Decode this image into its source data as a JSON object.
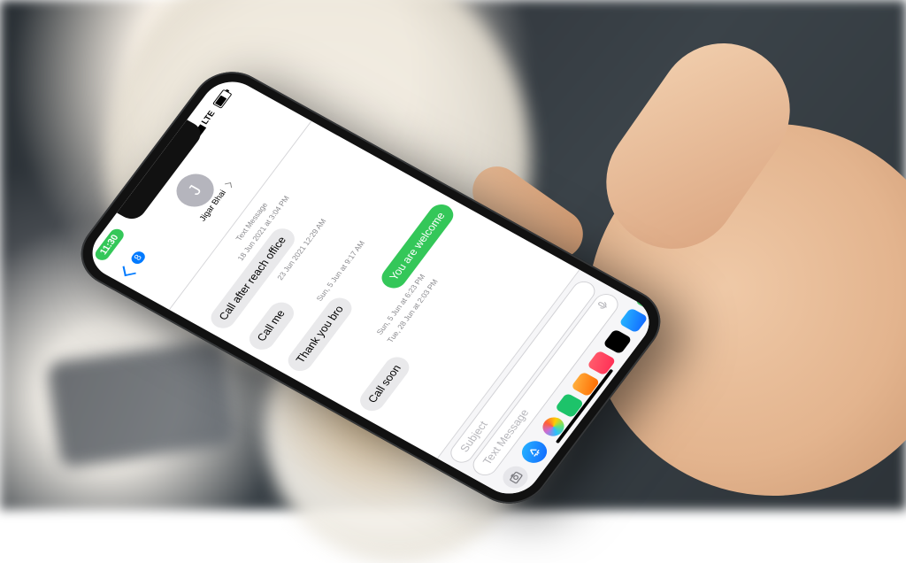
{
  "statusbar": {
    "time": "11:30",
    "carrier": "LTE"
  },
  "nav": {
    "back_count": "8",
    "avatar_initial": "J",
    "contact_name": "Jigar Bhai"
  },
  "thread": {
    "system_label": "Text Message",
    "ts0": "18 Jun 2021 at 3:04 PM",
    "msg0": "Call after reach office",
    "ts1": "23 Jun 2021 12:29 AM",
    "msg1": "Call me",
    "ts2": "Sun, 5 Jun at 9:17 AM",
    "msg2": "Thank you bro",
    "msg3": "You are welcome",
    "ts3": "Sun, 5 Jun at 6:23 PM",
    "ts4": "Tue, 28 Jun at 2:03 PM",
    "msg4": "Call soon"
  },
  "input": {
    "subject_placeholder": "Subject",
    "message_placeholder": "Text Message"
  }
}
